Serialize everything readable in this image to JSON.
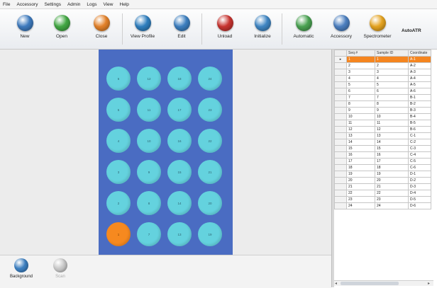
{
  "menu": [
    "File",
    "Accessory",
    "Settings",
    "Admin",
    "Logs",
    "View",
    "Help"
  ],
  "toolbar": [
    {
      "label": "New",
      "icon": "new-icon",
      "color": "#3e7bbf"
    },
    {
      "label": "Open",
      "icon": "open-icon",
      "color": "#42a843"
    },
    {
      "label": "Close",
      "icon": "close-icon",
      "color": "#e4822a"
    },
    {
      "label": "View Profile",
      "icon": "view-profile-icon",
      "color": "#2f7fbf"
    },
    {
      "label": "Edit",
      "icon": "edit-icon",
      "color": "#3c7fc0"
    },
    {
      "label": "Unload",
      "icon": "unload-icon",
      "color": "#c93430"
    },
    {
      "label": "Initialize",
      "icon": "initialize-icon",
      "color": "#3f86c4"
    },
    {
      "label": "Automatic",
      "icon": "automatic-icon",
      "color": "#4aa352"
    },
    {
      "label": "Accessory",
      "icon": "accessory-icon",
      "color": "#4b7fc0"
    },
    {
      "label": "Spectrometer",
      "icon": "spectrometer-icon",
      "color": "#e6a420"
    }
  ],
  "brand": "AutoATR",
  "plate": {
    "wells": [
      [
        "6",
        "12",
        "18",
        "24"
      ],
      [
        "5",
        "11",
        "17",
        "23"
      ],
      [
        "4",
        "10",
        "16",
        "22"
      ],
      [
        "3",
        "9",
        "15",
        "21"
      ],
      [
        "2",
        "8",
        "14",
        "20"
      ],
      [
        "1",
        "7",
        "13",
        "19"
      ]
    ],
    "active_well": "1",
    "colors": {
      "plate": "#4a6cc2",
      "well": "#64d2de",
      "active_well": "#f6891f"
    }
  },
  "bottom": [
    {
      "label": "Background",
      "icon": "background-icon",
      "color": "#3c7fc0"
    },
    {
      "label": "Scan",
      "icon": "scan-icon",
      "color": "#c8c8c8"
    }
  ],
  "grid": {
    "headers": [
      "Seq #",
      "Sample ID",
      "Coordinate"
    ],
    "rows": [
      [
        "1",
        "1",
        "A-1"
      ],
      [
        "2",
        "2",
        "A-2"
      ],
      [
        "3",
        "3",
        "A-3"
      ],
      [
        "4",
        "4",
        "A-4"
      ],
      [
        "5",
        "5",
        "A-5"
      ],
      [
        "6",
        "6",
        "A-6"
      ],
      [
        "7",
        "7",
        "B-1"
      ],
      [
        "8",
        "8",
        "B-2"
      ],
      [
        "9",
        "9",
        "B-3"
      ],
      [
        "10",
        "10",
        "B-4"
      ],
      [
        "11",
        "11",
        "B-5"
      ],
      [
        "12",
        "12",
        "B-6"
      ],
      [
        "13",
        "13",
        "C-1"
      ],
      [
        "14",
        "14",
        "C-2"
      ],
      [
        "15",
        "15",
        "C-3"
      ],
      [
        "16",
        "16",
        "C-4"
      ],
      [
        "17",
        "17",
        "C-5"
      ],
      [
        "18",
        "18",
        "C-6"
      ],
      [
        "19",
        "19",
        "D-1"
      ],
      [
        "20",
        "20",
        "D-2"
      ],
      [
        "21",
        "21",
        "D-3"
      ],
      [
        "22",
        "22",
        "D-4"
      ],
      [
        "23",
        "23",
        "D-5"
      ],
      [
        "24",
        "24",
        "D-6"
      ]
    ],
    "selected_index": 0,
    "row_marker": "▸"
  }
}
